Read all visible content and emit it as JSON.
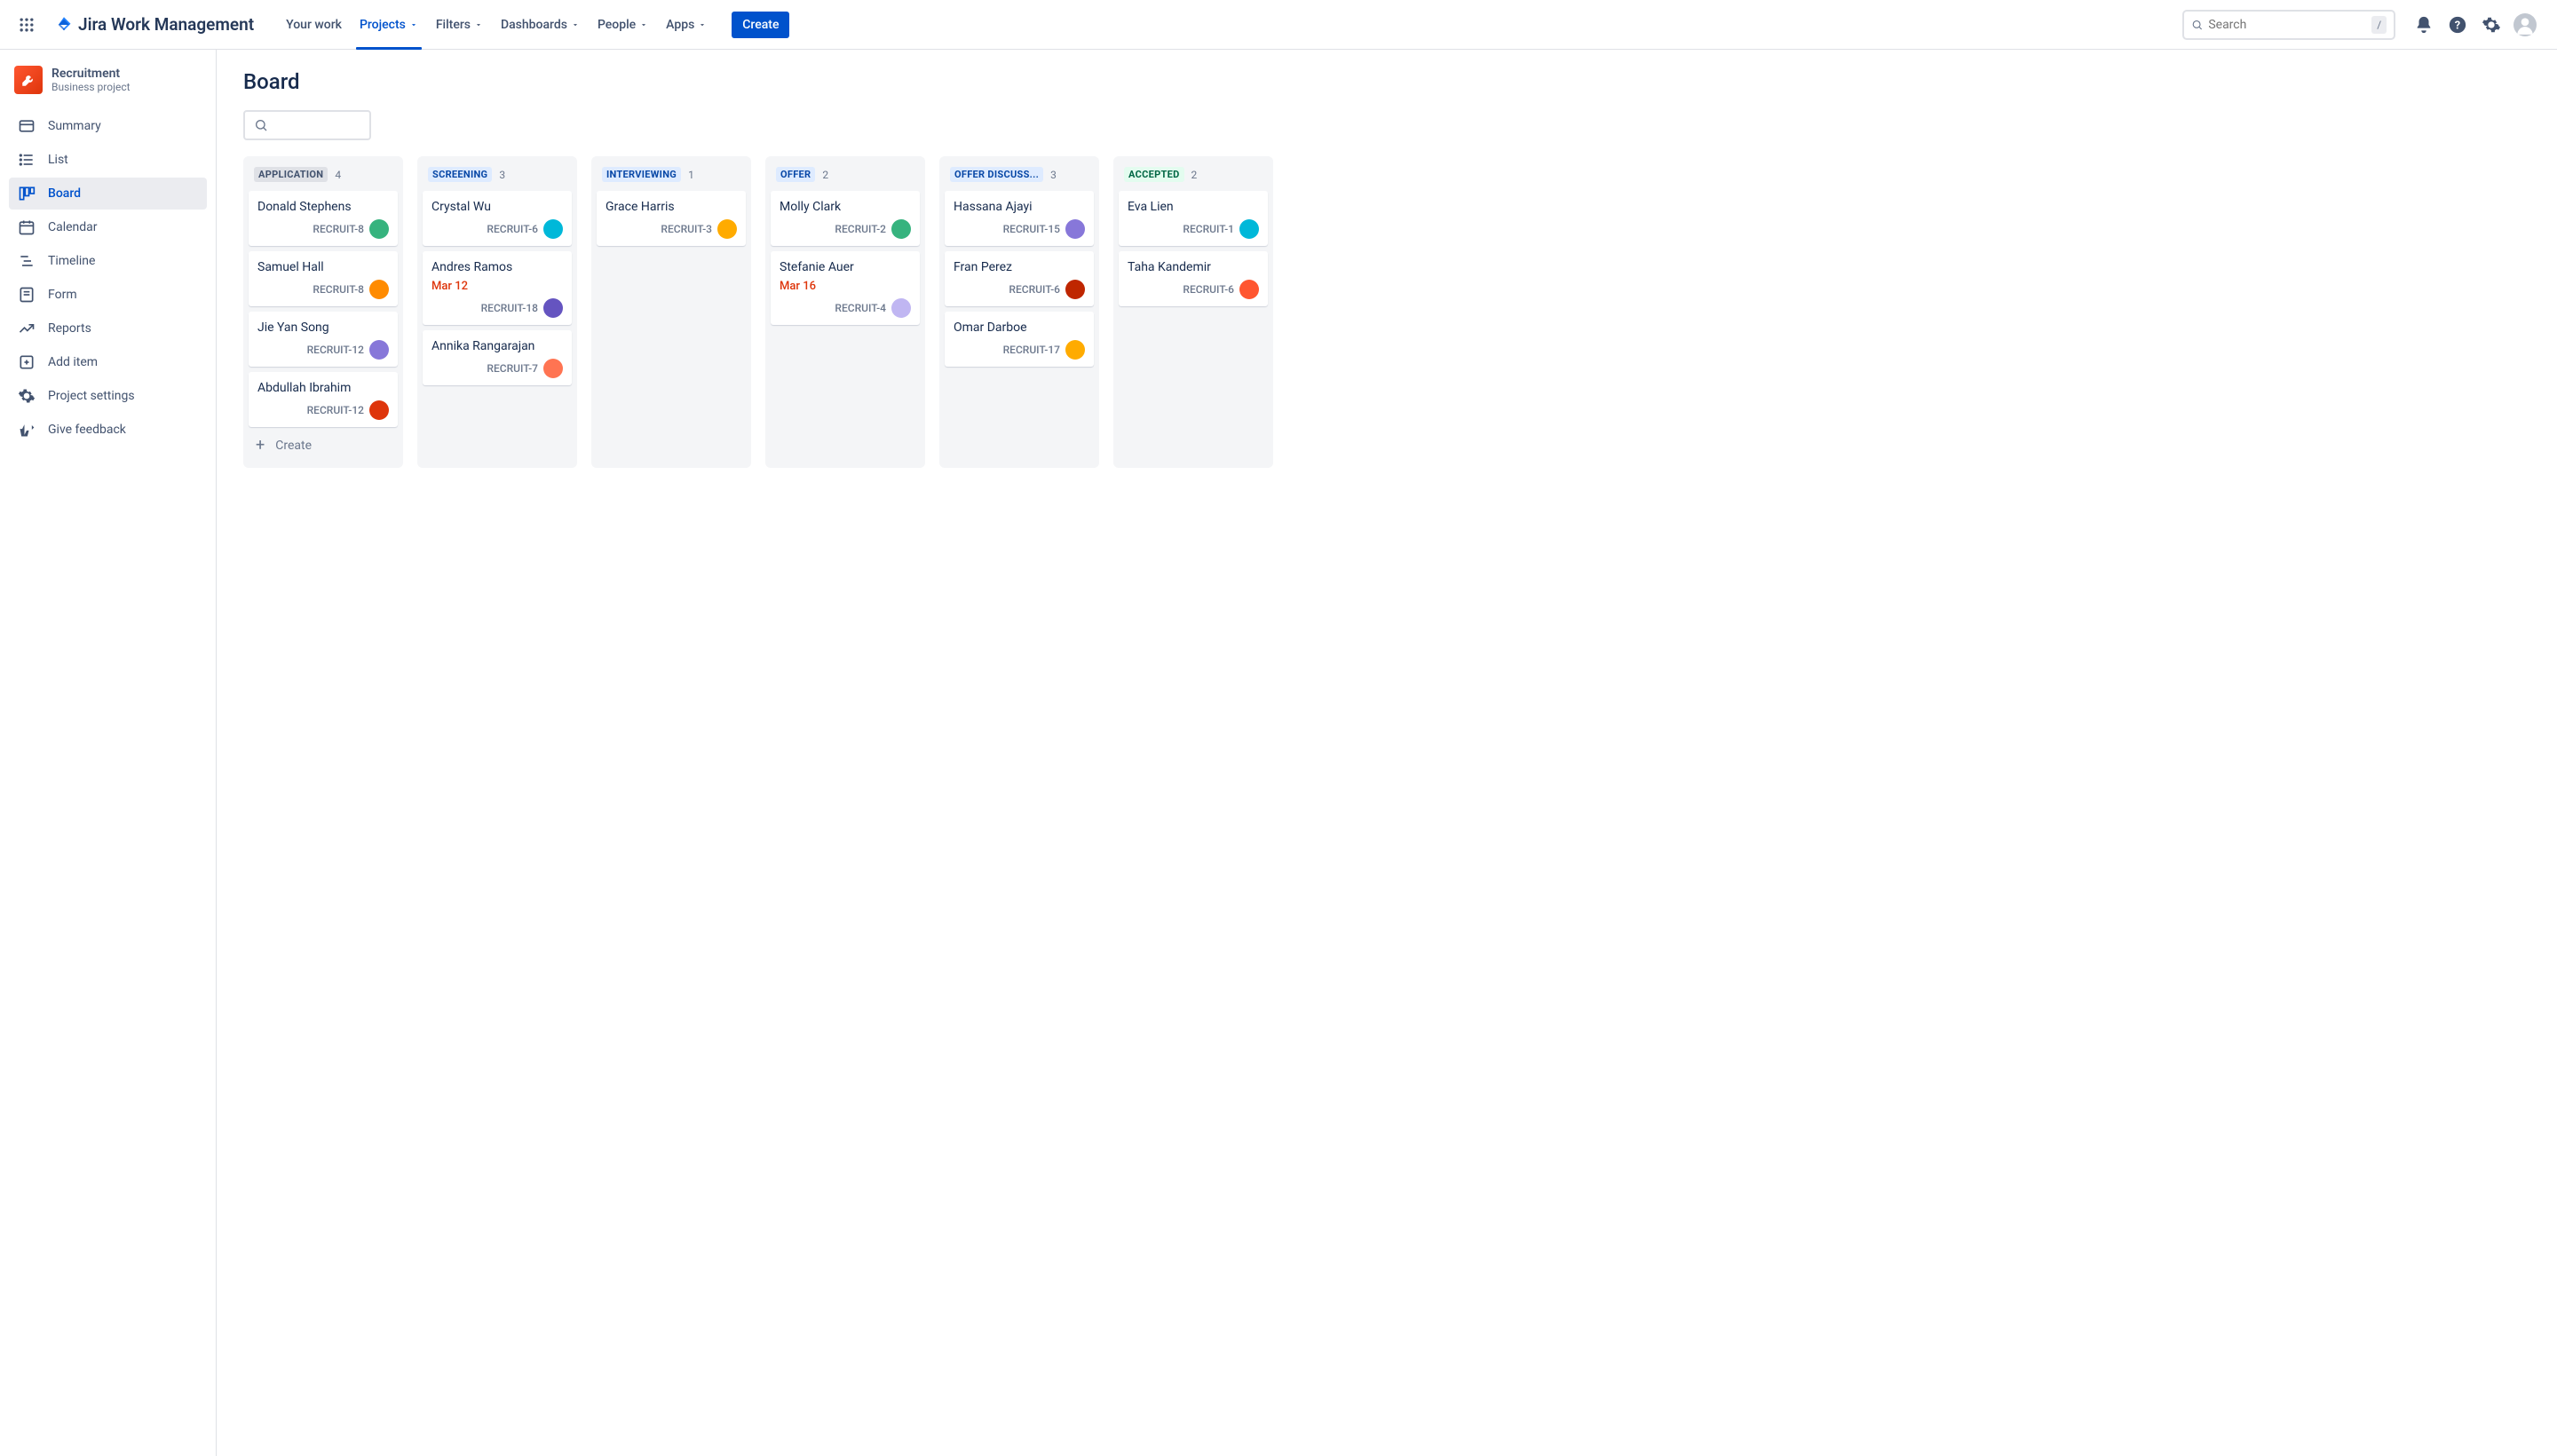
{
  "brand": "Jira Work Management",
  "nav": {
    "items": [
      "Your work",
      "Projects",
      "Filters",
      "Dashboards",
      "People",
      "Apps"
    ],
    "active_index": 1,
    "create_label": "Create"
  },
  "search": {
    "placeholder": "Search",
    "shortcut": "/"
  },
  "project": {
    "name": "Recruitment",
    "subtitle": "Business project"
  },
  "sidebar": {
    "items": [
      "Summary",
      "List",
      "Board",
      "Calendar",
      "Timeline",
      "Form",
      "Reports",
      "Add item",
      "Project settings",
      "Give feedback"
    ],
    "active_index": 2
  },
  "page": {
    "title": "Board",
    "create_card_label": "Create"
  },
  "columns": [
    {
      "title": "APPLICATION",
      "status_color": "gray",
      "count": 4,
      "cards": [
        {
          "name": "Donald Stephens",
          "key": "RECRUIT-8",
          "avatar_color": "#36b37e"
        },
        {
          "name": "Samuel Hall",
          "key": "RECRUIT-8",
          "avatar_color": "#ff8b00"
        },
        {
          "name": "Jie Yan Song",
          "key": "RECRUIT-12",
          "avatar_color": "#8777d9"
        },
        {
          "name": "Abdullah Ibrahim",
          "key": "RECRUIT-12",
          "avatar_color": "#de350b"
        }
      ],
      "show_create": true
    },
    {
      "title": "SCREENING",
      "status_color": "blue",
      "count": 3,
      "cards": [
        {
          "name": "Crystal Wu",
          "key": "RECRUIT-6",
          "avatar_color": "#00b8d9"
        },
        {
          "name": "Andres Ramos",
          "key": "RECRUIT-18",
          "date": "Mar 12",
          "avatar_color": "#6554c0"
        },
        {
          "name": "Annika Rangarajan",
          "key": "RECRUIT-7",
          "avatar_color": "#ff7452"
        }
      ]
    },
    {
      "title": "INTERVIEWING",
      "status_color": "blue",
      "count": 1,
      "cards": [
        {
          "name": "Grace Harris",
          "key": "RECRUIT-3",
          "avatar_color": "#ffab00"
        }
      ]
    },
    {
      "title": "OFFER",
      "status_color": "blue",
      "count": 2,
      "cards": [
        {
          "name": "Molly Clark",
          "key": "RECRUIT-2",
          "avatar_color": "#36b37e"
        },
        {
          "name": "Stefanie Auer",
          "key": "RECRUIT-4",
          "date": "Mar 16",
          "avatar_color": "#c0b6f2"
        }
      ]
    },
    {
      "title": "OFFER DISCUSS...",
      "status_color": "blue",
      "count": 3,
      "cards": [
        {
          "name": "Hassana Ajayi",
          "key": "RECRUIT-15",
          "avatar_color": "#8777d9"
        },
        {
          "name": "Fran Perez",
          "key": "RECRUIT-6",
          "avatar_color": "#bf2600"
        },
        {
          "name": "Omar Darboe",
          "key": "RECRUIT-17",
          "avatar_color": "#ffab00"
        }
      ]
    },
    {
      "title": "ACCEPTED",
      "status_color": "green",
      "count": 2,
      "cards": [
        {
          "name": "Eva Lien",
          "key": "RECRUIT-1",
          "avatar_color": "#00b8d9"
        },
        {
          "name": "Taha Kandemir",
          "key": "RECRUIT-6",
          "avatar_color": "#ff5630"
        }
      ]
    }
  ],
  "status_colors": {
    "gray": {
      "bg": "#dfe1e6",
      "fg": "#42526e"
    },
    "blue": {
      "bg": "#deebff",
      "fg": "#0747a6"
    },
    "green": {
      "bg": "#e3fcef",
      "fg": "#006644"
    }
  }
}
